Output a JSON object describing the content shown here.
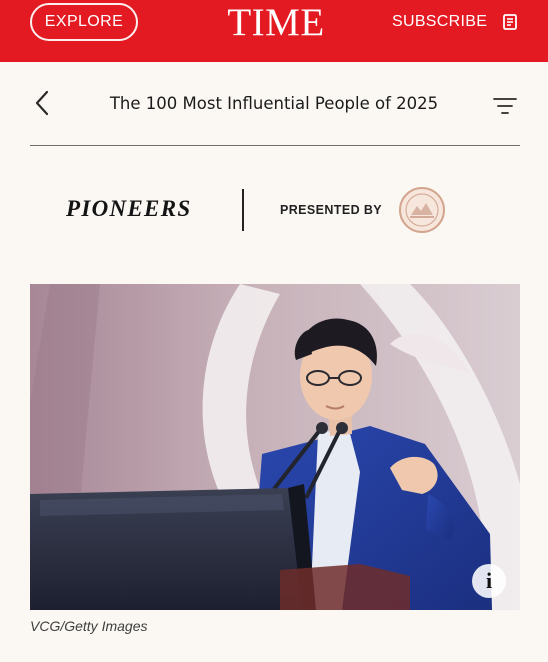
{
  "header": {
    "explore_label": "EXPLORE",
    "logo_text": "TIME",
    "subscribe_label": "SUBSCRIBE",
    "issue_icon": "magazine-icon",
    "background_color": "#e31a22"
  },
  "nav": {
    "back_icon": "chevron-left-icon",
    "title": "The 100 Most Influential People of 2025",
    "filter_icon": "filter-lines-icon"
  },
  "section": {
    "category": "PIONEERS",
    "presented_by": "PRESENTED BY",
    "sponsor_logo": "sponsor-seal-logo"
  },
  "photo": {
    "description_icon": "info-icon",
    "info_label": "i",
    "credit": "VCG/Getty Images"
  }
}
